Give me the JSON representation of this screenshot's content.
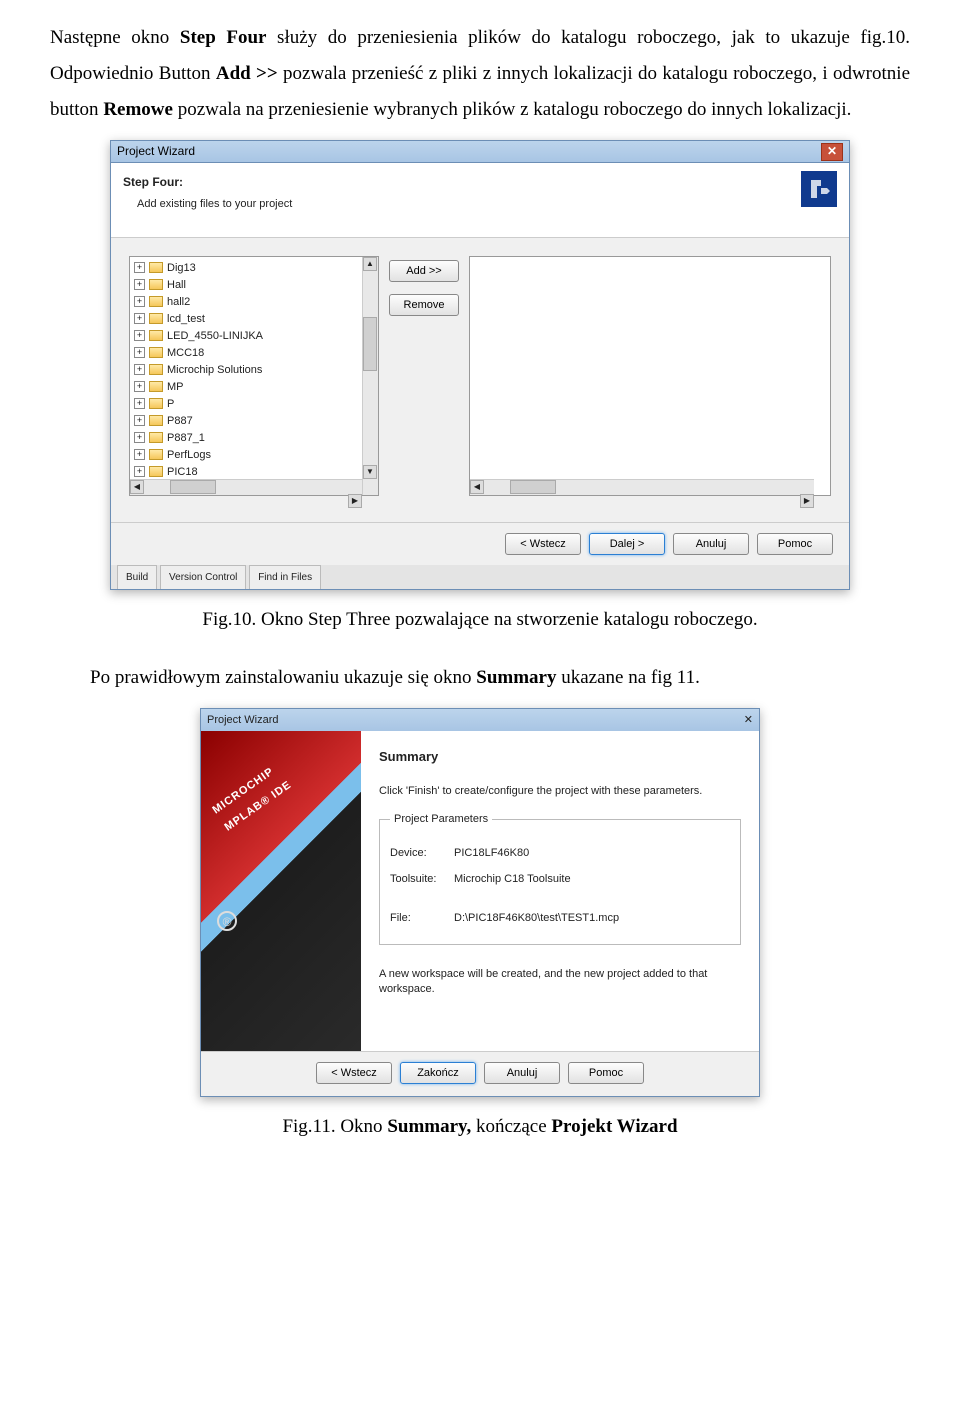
{
  "text": {
    "p1a": "Następne okno ",
    "p1b": "Step Four",
    "p1c": " służy do przeniesienia plików do katalogu roboczego, jak to ukazuje fig.10. Odpowiednio Button ",
    "p1d": "Add >>",
    "p1e": " pozwala przenieść z pliki z innych lokalizacji do katalogu roboczego, i odwrotnie button ",
    "p1f": "Remowe",
    "p1g": " pozwala na przeniesienie wybranych plików z katalogu roboczego do innych lokalizacji.",
    "cap1": "Fig.10. Okno Step Three pozwalające na stworzenie katalogu roboczego.",
    "p2a": "Po prawidłowym zainstalowaniu ukazuje się okno ",
    "p2b": "Summary",
    "p2c": " ukazane na fig 11.",
    "cap2a": "Fig.11. Okno ",
    "cap2b": "Summary,",
    "cap2c": " kończące ",
    "cap2d": "Projekt Wizard"
  },
  "ss1": {
    "title": "Project Wizard",
    "step_title": "Step Four:",
    "step_sub": "Add existing files to your project",
    "tree_items": [
      "Dig13",
      "Hall",
      "hall2",
      "lcd_test",
      "LED_4550-LINIJKA",
      "MCC18",
      "Microchip Solutions",
      "MP",
      "P",
      "P887",
      "P887_1",
      "PerfLogs",
      "PIC18"
    ],
    "btn_add": "Add >>",
    "btn_remove": "Remove",
    "footer": {
      "back": "< Wstecz",
      "next": "Dalej >",
      "cancel": "Anuluj",
      "help": "Pomoc"
    },
    "tabs": {
      "build": "Build",
      "vc": "Version Control",
      "fif": "Find in Files"
    }
  },
  "ss2": {
    "title": "Project Wizard",
    "heading": "Summary",
    "intro": "Click 'Finish' to create/configure the project with these parameters.",
    "legend": "Project Parameters",
    "device_k": "Device:",
    "device_v": "PIC18LF46K80",
    "tool_k": "Toolsuite:",
    "tool_v": "Microchip C18 Toolsuite",
    "file_k": "File:",
    "file_v": "D:\\PIC18F46K80\\test\\TEST1.mcp",
    "wsnote": "A new workspace will be created, and the new project added to that workspace.",
    "side_text": "MICROCHIP\nMPLAB® IDE",
    "footer": {
      "back": "< Wstecz",
      "finish": "Zakończ",
      "cancel": "Anuluj",
      "help": "Pomoc"
    }
  }
}
